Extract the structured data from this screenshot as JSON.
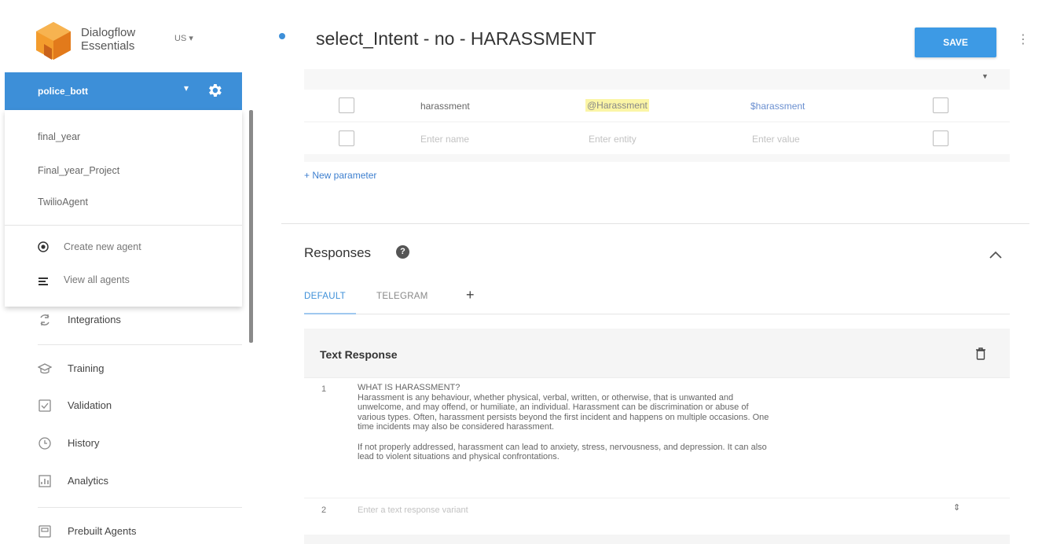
{
  "brand": {
    "name_line1": "Dialogflow",
    "name_line2": "Essentials",
    "region": "US ▾",
    "logo_color": "#f08a24"
  },
  "agent": {
    "current": "police_bott",
    "caret": "▾",
    "accent": "#3d8fd8"
  },
  "agent_dropdown": {
    "agents": [
      "final_year",
      "Final_year_Project",
      "TwilioAgent"
    ],
    "actions": [
      {
        "label": "Create new agent",
        "icon": "add-circle-icon"
      },
      {
        "label": "View all agents",
        "icon": "list-icon"
      }
    ]
  },
  "nav": [
    {
      "label": "Integrations",
      "icon": "integrations-icon"
    },
    {
      "label": "Training",
      "icon": "training-icon"
    },
    {
      "label": "Validation",
      "icon": "validation-icon"
    },
    {
      "label": "History",
      "icon": "history-icon"
    },
    {
      "label": "Analytics",
      "icon": "analytics-icon"
    },
    {
      "label": "Prebuilt Agents",
      "icon": "prebuilt-agents-icon"
    }
  ],
  "header": {
    "title": "select_Intent - no - HARASSMENT",
    "save_label": "SAVE",
    "more_label": "⋮"
  },
  "parameters": {
    "rows": [
      {
        "name": "harassment",
        "entity": "@Harassment",
        "value": "$harassment"
      }
    ],
    "placeholder": {
      "name": "Enter name",
      "entity": "Enter entity",
      "value": "Enter value"
    },
    "new_parameter": "+ New parameter"
  },
  "responses": {
    "title": "Responses",
    "help": "?",
    "tabs": [
      "DEFAULT",
      "TELEGRAM"
    ],
    "add_tab": "+",
    "card_title": "Text Response",
    "items": [
      {
        "num": "1",
        "text": "WHAT IS HARASSMENT?\nHarassment is any behaviour, whether physical, verbal, written, or otherwise, that is unwanted and\nunwelcome, and may offend, or humiliate, an individual. Harassment can be discrimination or abuse of\nvarious types. Often, harassment persists beyond the first incident and happens on multiple occasions. One\ntime incidents may also be considered harassment.\n\nIf not properly addressed, harassment can lead to anxiety, stress, nervousness, and depression. It can also\nlead to violent situations and physical confrontations."
      }
    ],
    "next_num": "2",
    "variant_placeholder": "Enter a text response variant"
  }
}
